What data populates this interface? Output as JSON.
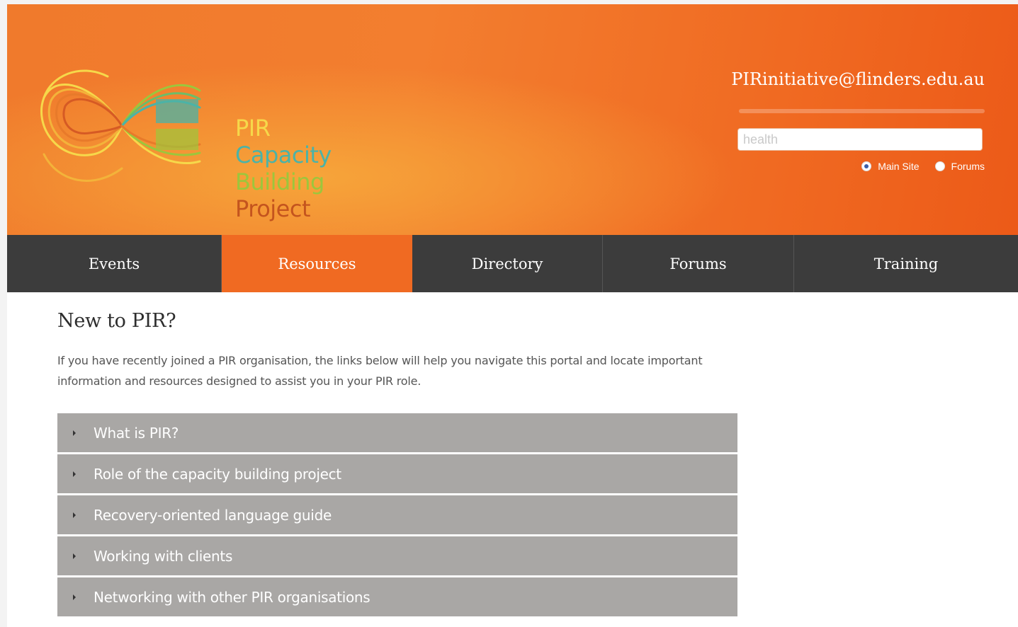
{
  "logo": {
    "lines": [
      "PIR",
      "Capacity",
      "Building",
      "Project"
    ],
    "colors": [
      "#f6d84a",
      "#4bb3a7",
      "#9cc63c",
      "#c4541e"
    ]
  },
  "header": {
    "email": "PIRinitiative@flinders.edu.au",
    "search": {
      "value": "health"
    },
    "search_scope": {
      "options": [
        "Main Site",
        "Forums"
      ],
      "selected": "Main Site"
    }
  },
  "nav": {
    "items": [
      {
        "label": "Events"
      },
      {
        "label": "Resources"
      },
      {
        "label": "Directory"
      },
      {
        "label": "Forums"
      },
      {
        "label": "Training"
      }
    ],
    "active": "Resources"
  },
  "main": {
    "title": "New to PIR?",
    "intro": "If you have recently joined a PIR organisation, the links below will help you navigate this portal and locate important information and resources designed to assist you in your PIR role.",
    "accordion": [
      {
        "label": "What is PIR?"
      },
      {
        "label": "Role of the capacity building project"
      },
      {
        "label": "Recovery-oriented language guide"
      },
      {
        "label": "Working with clients"
      },
      {
        "label": "Networking with other PIR organisations"
      }
    ]
  },
  "colors": {
    "brand_orange": "#f06a22",
    "nav_dark": "#3c3c3c",
    "accordion_gray": "#a9a7a5"
  }
}
